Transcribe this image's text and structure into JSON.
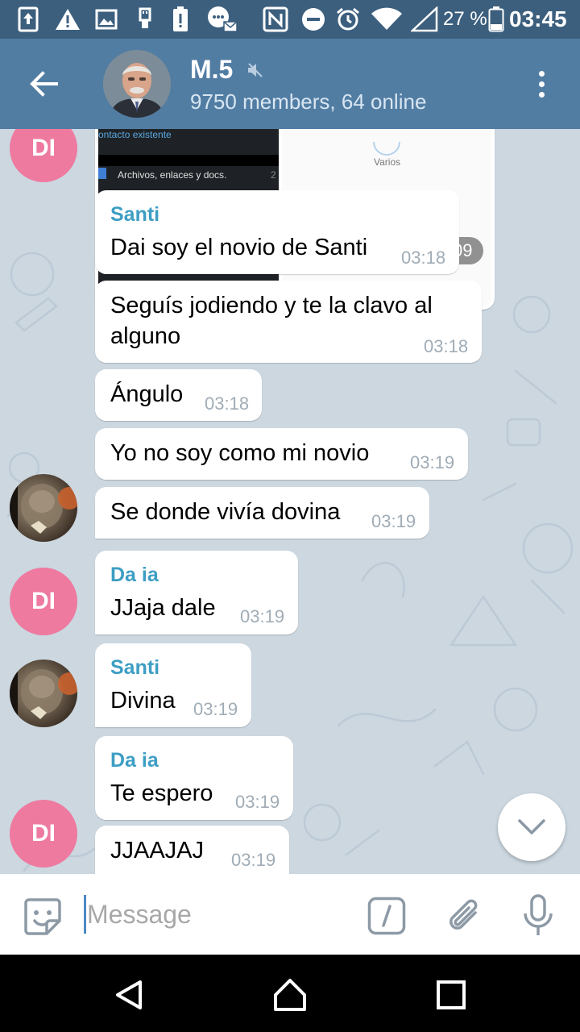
{
  "status_bar": {
    "battery_percent": "27 %",
    "time": "03:45"
  },
  "header": {
    "title": "M.5",
    "subtitle": "9750 members, 64 online",
    "muted": true
  },
  "media_message": {
    "left_caption_top": "ontacto existente",
    "left_caption_bottom": "Archivos, enlaces y docs.",
    "left_caption_count": "2",
    "right_label": "Varios",
    "time": "03:09"
  },
  "messages": [
    {
      "sender": "Santi",
      "text": "Dai soy el novio de Santi",
      "time": "03:18"
    },
    {
      "text_line1": "Seguís jodiendo y te la clavo al",
      "text_line2": "alguno",
      "time": "03:18"
    },
    {
      "text": "Ángulo",
      "time": "03:18"
    },
    {
      "text": "Yo no soy como mi novio",
      "time": "03:19"
    },
    {
      "text": "Se donde vivía dovina",
      "time": "03:19"
    },
    {
      "sender": "Da ia",
      "text": "JJaja dale",
      "time": "03:19"
    },
    {
      "sender": "Santi",
      "text": "Divina",
      "time": "03:19"
    },
    {
      "sender": "Da ia",
      "text": "Te espero",
      "time": "03:19"
    },
    {
      "text": "JJAAJAJ",
      "time": "03:19"
    }
  ],
  "avatars": {
    "di_initials": "DI"
  },
  "input": {
    "placeholder": "Message"
  },
  "colors": {
    "status_bar": "#3c5f7e",
    "header": "#527da3",
    "chat_background": "#ccd7e0",
    "sender_name": "#3d9ec4",
    "avatar_di": "#ee7aa0",
    "time_text": "#a0acb6"
  },
  "icons": {
    "back": "arrow-left-icon",
    "mute": "speaker-muted-icon",
    "menu": "more-vertical-icon",
    "scroll_down": "chevron-down-icon",
    "sticker": "sticker-icon",
    "command": "slash-command-icon",
    "attach": "paperclip-icon",
    "mic": "microphone-icon",
    "nav_back": "triangle-back-icon",
    "nav_home": "home-icon",
    "nav_recents": "square-recents-icon"
  }
}
